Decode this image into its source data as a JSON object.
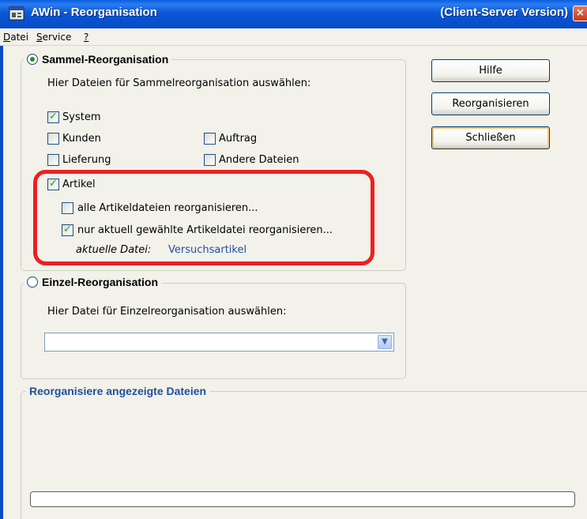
{
  "window": {
    "title": "AWin - Reorganisation",
    "title_right": "(Client-Server Version)",
    "close_label": "×"
  },
  "menu": {
    "items": [
      {
        "label": "Datei",
        "underline": "D",
        "rest": "atei"
      },
      {
        "label": "Service",
        "underline": "S",
        "rest": "ervice"
      },
      {
        "label": "?",
        "underline": "?",
        "rest": ""
      }
    ]
  },
  "sammel": {
    "legend": "Sammel-Reorganisation",
    "selected": true,
    "instruction": "Hier Dateien für Sammelreorganisation auswählen:",
    "checkboxes": {
      "system": {
        "label": "System",
        "checked": true
      },
      "kunden": {
        "label": "Kunden",
        "checked": false
      },
      "auftrag": {
        "label": "Auftrag",
        "checked": false
      },
      "lieferung": {
        "label": "Lieferung",
        "checked": false
      },
      "andere": {
        "label": "Andere Dateien",
        "checked": false
      },
      "artikel": {
        "label": "Artikel",
        "checked": true
      },
      "alle_artikel": {
        "label": "alle Artikeldateien reorganisieren...",
        "checked": false
      },
      "nur_aktuell": {
        "label": "nur aktuell gewählte Artikeldatei reorganisieren...",
        "checked": true
      }
    },
    "current_file_label": "aktuelle Datei:",
    "current_file_value": "Versuchsartikel"
  },
  "einzel": {
    "legend": "Einzel-Reorganisation",
    "selected": false,
    "instruction": "Hier Datei für Einzelreorganisation auswählen:",
    "select_value": ""
  },
  "buttons": {
    "hilfe": "Hilfe",
    "reorganisieren": "Reorganisieren",
    "schliessen": "Schließen"
  },
  "progress_section": {
    "legend": "Reorganisiere angezeigte Dateien",
    "progress_percent": 0
  },
  "colors": {
    "titlebar": "#0a5ddf",
    "highlight": "#ec2020",
    "legend_blue": "#1f4f9c",
    "link_blue": "#1f4f9c"
  }
}
